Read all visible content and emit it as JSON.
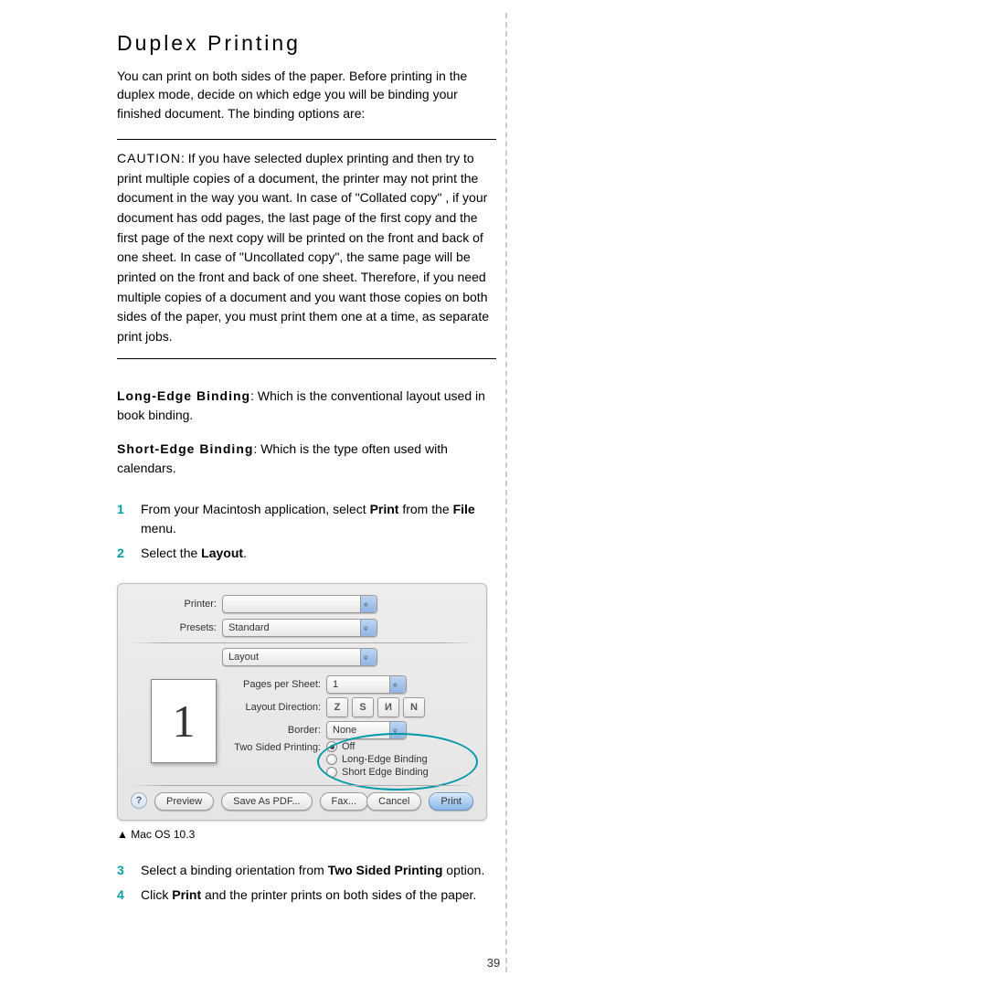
{
  "title": "Duplex Printing",
  "intro": "You can print on both sides of the paper. Before printing in the duplex mode, decide on which edge you will be binding your finished document. The binding options are:",
  "caution": {
    "label": "CAUTION",
    "text": ": If you have selected duplex printing and then try to print multiple copies of a document, the printer may not print the document in the way you want. In case of  \"Collated copy\" , if your document has odd pages, the last page of the first copy and the first page of the next copy will be printed on the front and back of one sheet. In case of  \"Uncollated copy\", the same page will be printed on the front and back of one sheet. Therefore, if you need multiple copies of a document and you want those copies on both sides of the paper, you must print them one at a time, as separate print jobs."
  },
  "long_edge": {
    "label": "Long-Edge Binding",
    "text": ": Which is the conventional layout used in book binding."
  },
  "short_edge": {
    "label": "Short-Edge Binding",
    "text": ": Which is the type often used with calendars."
  },
  "steps_a": [
    {
      "num": "1",
      "text_a": "From your Macintosh application, select ",
      "bold": "Print",
      "text_b": " from the ",
      "bold2": "File",
      "text_c": " menu."
    },
    {
      "num": "2",
      "text_a": "Select the ",
      "bold": "Layout",
      "text_b": "."
    }
  ],
  "dialog": {
    "printer_label": "Printer:",
    "presets_label": "Presets:",
    "presets_value": "Standard",
    "section_value": "Layout",
    "pps_label": "Pages per Sheet:",
    "pps_value": "1",
    "dir_label": "Layout Direction:",
    "border_label": "Border:",
    "border_value": "None",
    "tsp_label": "Two Sided Printing:",
    "tsp_options": [
      "Off",
      "Long-Edge Binding",
      "Short Edge Binding"
    ],
    "thumb": "1",
    "help": "?",
    "buttons": {
      "preview": "Preview",
      "save_pdf": "Save As PDF...",
      "fax": "Fax...",
      "cancel": "Cancel",
      "print": "Print"
    }
  },
  "caption": "▲ Mac OS 10.3",
  "steps_b": [
    {
      "num": "3",
      "text_a": "Select a binding orientation from ",
      "bold": "Two Sided Printing",
      "text_b": " option."
    },
    {
      "num": "4",
      "text_a": "Click ",
      "bold": "Print",
      "text_b": " and the printer prints on both sides of the paper."
    }
  ],
  "page_number": "39"
}
